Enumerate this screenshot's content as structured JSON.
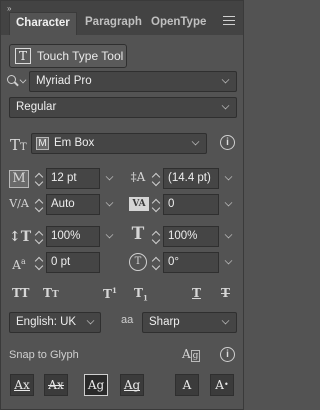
{
  "tabs": [
    {
      "label": "Character",
      "active": true
    },
    {
      "label": "Paragraph",
      "active": false
    },
    {
      "label": "OpenType",
      "active": false
    }
  ],
  "touch_type_button": {
    "label": "Touch Type Tool",
    "icon": "touch-type-icon"
  },
  "font_family": {
    "value": "Myriad Pro"
  },
  "font_style": {
    "value": "Regular"
  },
  "char_alignment": {
    "value": "Em Box"
  },
  "font_size": {
    "value": "12 pt"
  },
  "leading": {
    "value": "(14.4 pt)"
  },
  "kerning": {
    "value": "Auto"
  },
  "tracking": {
    "value": "0"
  },
  "vertical_scale": {
    "value": "100%"
  },
  "horizontal_scale": {
    "value": "100%"
  },
  "baseline_shift": {
    "value": "0 pt"
  },
  "character_rotation": {
    "value": "0°"
  },
  "text_styles": [
    "All Caps",
    "Small Caps",
    "Superscript",
    "Subscript",
    "Underline",
    "Strikethrough"
  ],
  "language": {
    "value": "English: UK"
  },
  "anti_aliasing": {
    "value": "Sharp",
    "label_icon": "aa"
  },
  "snap_to_glyph": {
    "label": "Snap to Glyph",
    "buttons": [
      "Baseline",
      "x-Height",
      "Glyph Bounds",
      "Proxy",
      "Angular",
      "Anchor Point"
    ]
  },
  "colors": {
    "panel_bg": "#535353",
    "tabstrip_bg": "#434343",
    "field_bg": "#454545"
  }
}
